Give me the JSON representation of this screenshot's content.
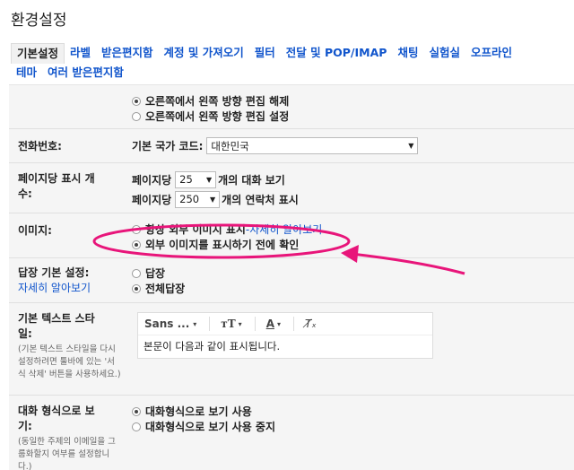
{
  "page_title": "환경설정",
  "tabs_row1": [
    "기본설정",
    "라벨",
    "받은편지함",
    "계정 및 가져오기",
    "필터",
    "전달 및 POP/IMAP",
    "채팅",
    "실험실",
    "오프라인"
  ],
  "tabs_row2": [
    "테마",
    "여러 받은편지함"
  ],
  "rows": {
    "rtl": {
      "opt1": "오른쪽에서 왼쪽 방향 편집 해제",
      "opt2": "오른쪽에서 왼쪽 방향 편집 설정"
    },
    "phone": {
      "label": "전화번호:",
      "prefix": "기본 국가 코드:",
      "country": "대한민국"
    },
    "page_size": {
      "label_line1": "페이지당 표시 개",
      "label_line2": "수:",
      "prefix1": "페이지당",
      "value1": "25",
      "suffix1": "개의 대화 보기",
      "prefix2": "페이지당",
      "value2": "250",
      "suffix2": "개의 연락처 표시"
    },
    "images": {
      "label": "이미지:",
      "opt1": "항상 외부 이미지 표시",
      "opt1_sep": " - ",
      "opt1_link": "자세히 알아보기",
      "opt2": "외부 이미지를 표시하기 전에 확인"
    },
    "reply": {
      "label": "답장 기본 설정:",
      "help": "자세히 알아보기",
      "opt1": "답장",
      "opt2": "전체답장"
    },
    "text_style": {
      "label_line1": "기본 텍스트 스타",
      "label_line2": "일:",
      "sub": "(기본 텍스트 스타일을 다시 설정하려면 툴바에 있는 '서식 삭제' 버튼을 사용하세요.)",
      "font": "Sans ...",
      "preview": "본문이 다음과 같이 표시됩니다."
    },
    "conversation": {
      "label_line1": "대화 형식으로 보",
      "label_line2": "기:",
      "sub": "(동일한 주제의 이메일을 그룹화할지 여부를 설정합니다.)",
      "opt1": "대화형식으로 보기 사용",
      "opt2": "대화형식으로 보기 사용 중지"
    }
  },
  "colors": {
    "link": "#1155cc",
    "annotation": "#e8157a"
  }
}
